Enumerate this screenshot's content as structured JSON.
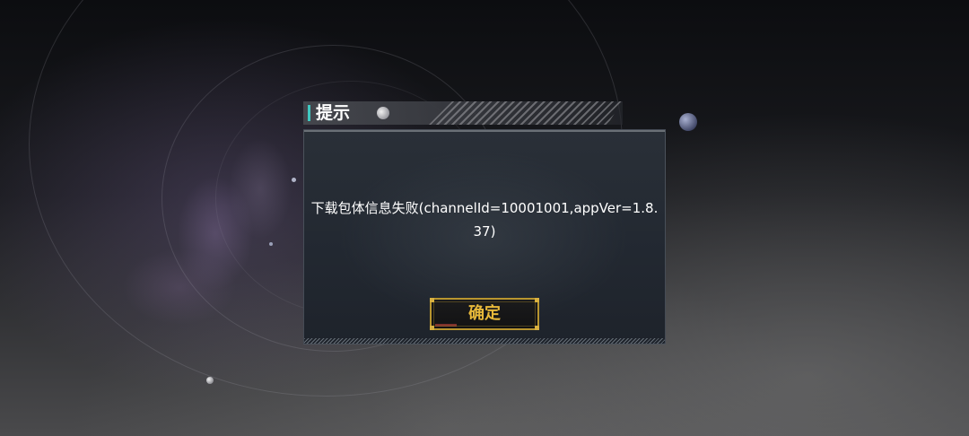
{
  "dialog": {
    "title": "提示",
    "message": "下载包体信息失败(channelId=10001001,appVer=1.8.37)",
    "confirm_label": "确定"
  },
  "colors": {
    "title_accent": "#3fc8c0",
    "button_border": "#b8952f",
    "button_text": "#e8b93a"
  },
  "icons": {
    "title_decoration": "moon-icon",
    "background_planet": "planet-icon"
  }
}
